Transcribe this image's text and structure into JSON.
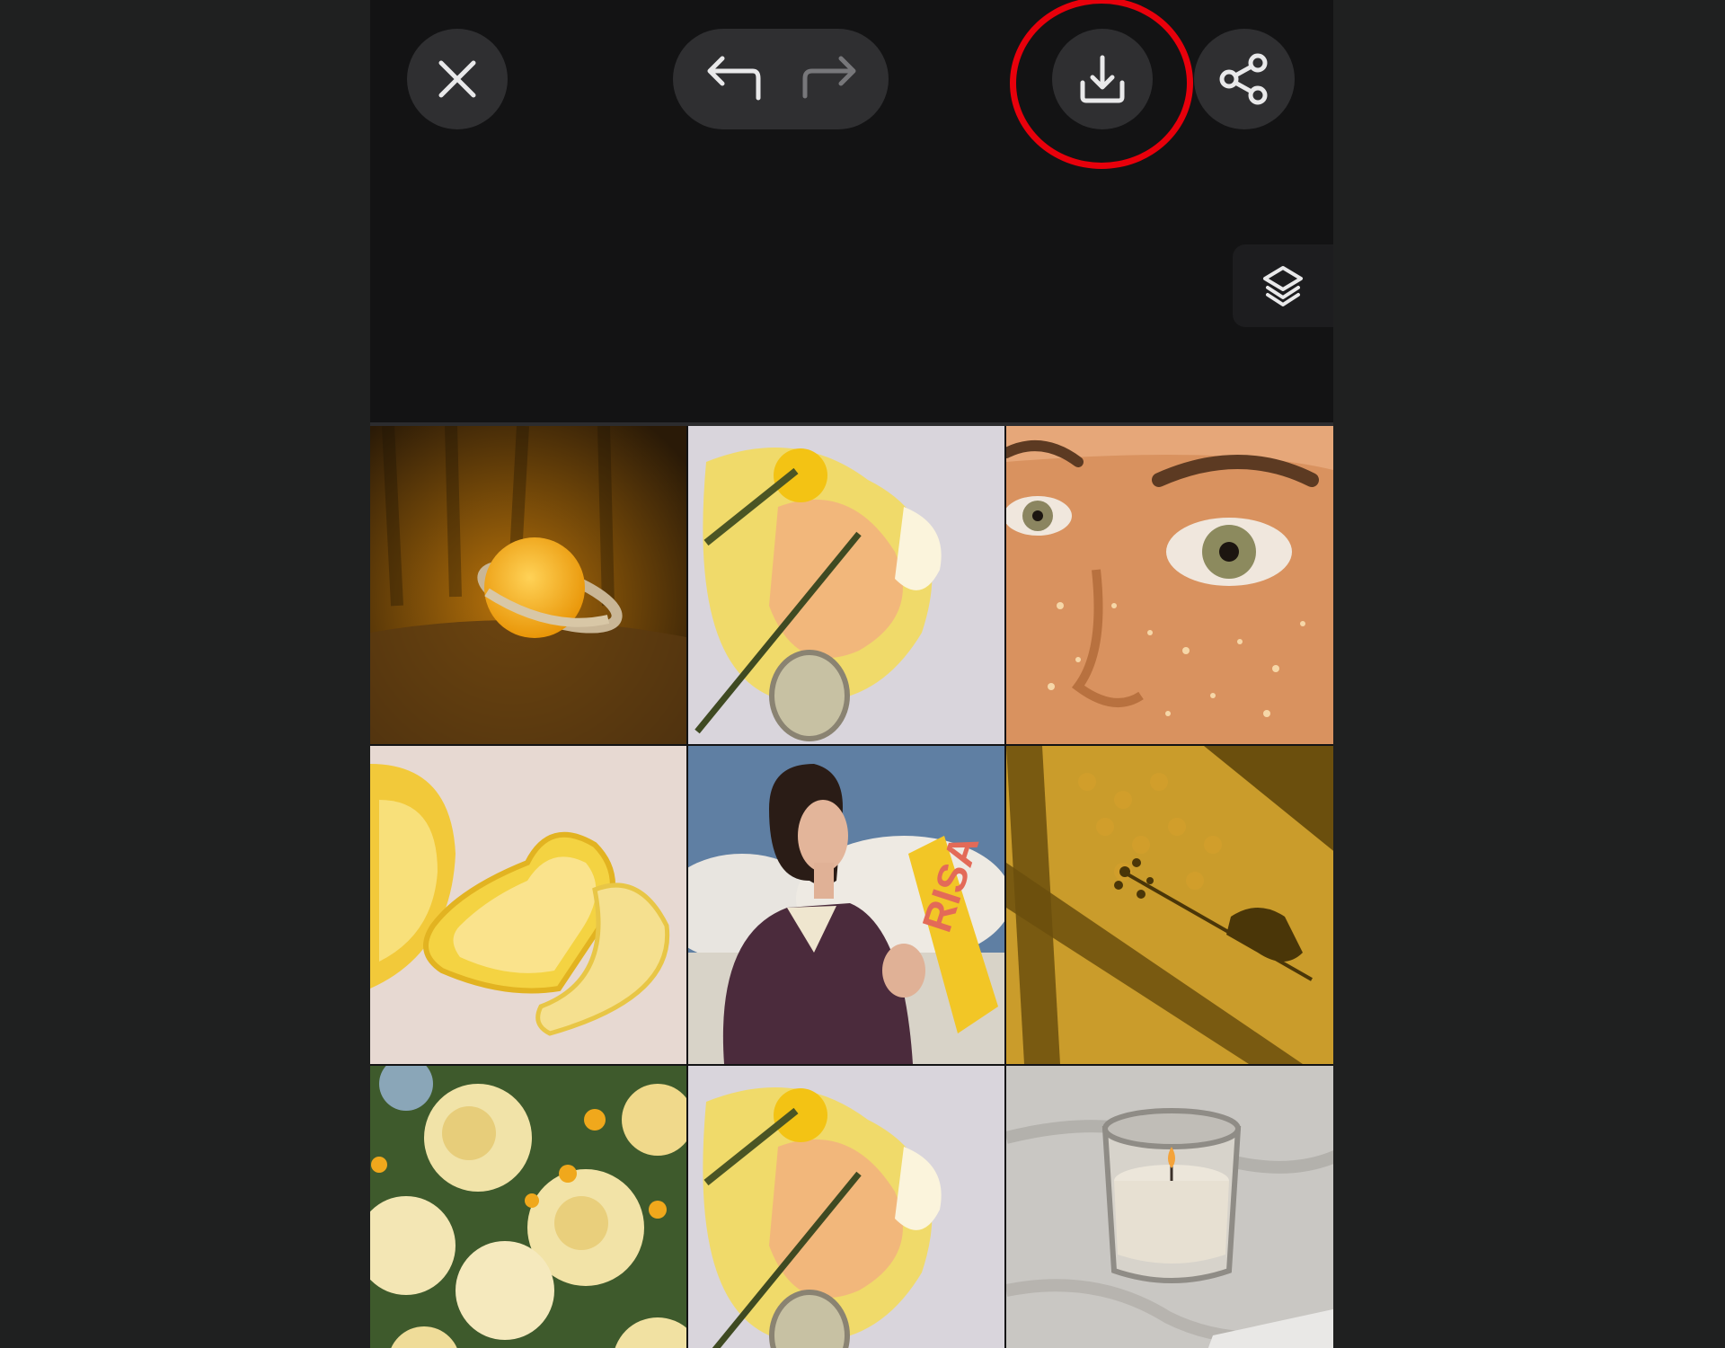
{
  "toolbar": {
    "close_icon": "close-icon",
    "undo_icon": "undo-icon",
    "redo_icon": "redo-icon",
    "download_icon": "download-icon",
    "share_icon": "share-icon",
    "layers_icon": "layers-icon",
    "highlighted_button": "download-button",
    "highlight_color": "#e8000b"
  },
  "colors": {
    "background": "#1f2020",
    "editor_background": "#131314",
    "button_fill": "#2f2f31",
    "icon_color": "#e9e9ea",
    "icon_disabled_color": "#77777a"
  },
  "collage": {
    "tiles": [
      {
        "subject": "planet-lamp"
      },
      {
        "subject": "paint-palette"
      },
      {
        "subject": "freckled-face"
      },
      {
        "subject": "heart-lemons"
      },
      {
        "subject": "woman-with-bottle",
        "bottle_text": "RISA"
      },
      {
        "subject": "hand-shadow-flower"
      },
      {
        "subject": "yellow-roses"
      },
      {
        "subject": "paint-palette"
      },
      {
        "subject": "candle-jar"
      }
    ]
  }
}
